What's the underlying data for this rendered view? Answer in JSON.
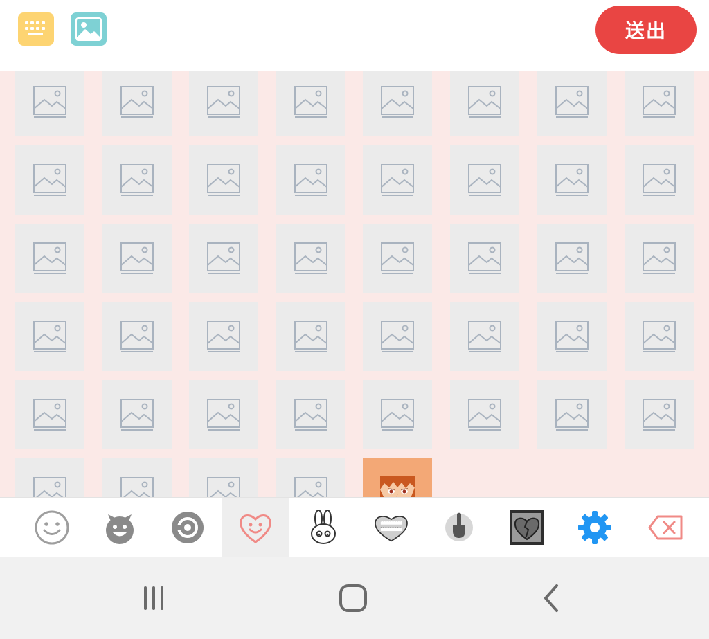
{
  "toolbar": {
    "keyboard_icon": "keyboard-icon",
    "image_icon": "image-icon",
    "send_label": "送出",
    "send_color": "#e94543"
  },
  "sticker_grid": {
    "background": "#fbe9e7",
    "placeholder_icon": "image-placeholder-icon",
    "columns": 8,
    "rows_visible": 6,
    "loaded_sticker": "anime-boy-sticker"
  },
  "tabs": [
    {
      "icon": "smiley-face-icon",
      "active": false
    },
    {
      "icon": "devil-face-icon",
      "active": false
    },
    {
      "icon": "spiral-face-icon",
      "active": false
    },
    {
      "icon": "heart-smile-icon",
      "active": true
    },
    {
      "icon": "bunny-icon",
      "active": false
    },
    {
      "icon": "love-callring-heart-icon",
      "active": false
    },
    {
      "icon": "thumbs-up-icon",
      "active": false
    },
    {
      "icon": "broken-heart-icon",
      "active": false
    },
    {
      "icon": "settings-gear-icon",
      "active": false
    }
  ],
  "backspace_icon": "backspace-icon",
  "nav": {
    "recents_icon": "recents-icon",
    "home_icon": "home-icon",
    "back_icon": "back-icon"
  }
}
